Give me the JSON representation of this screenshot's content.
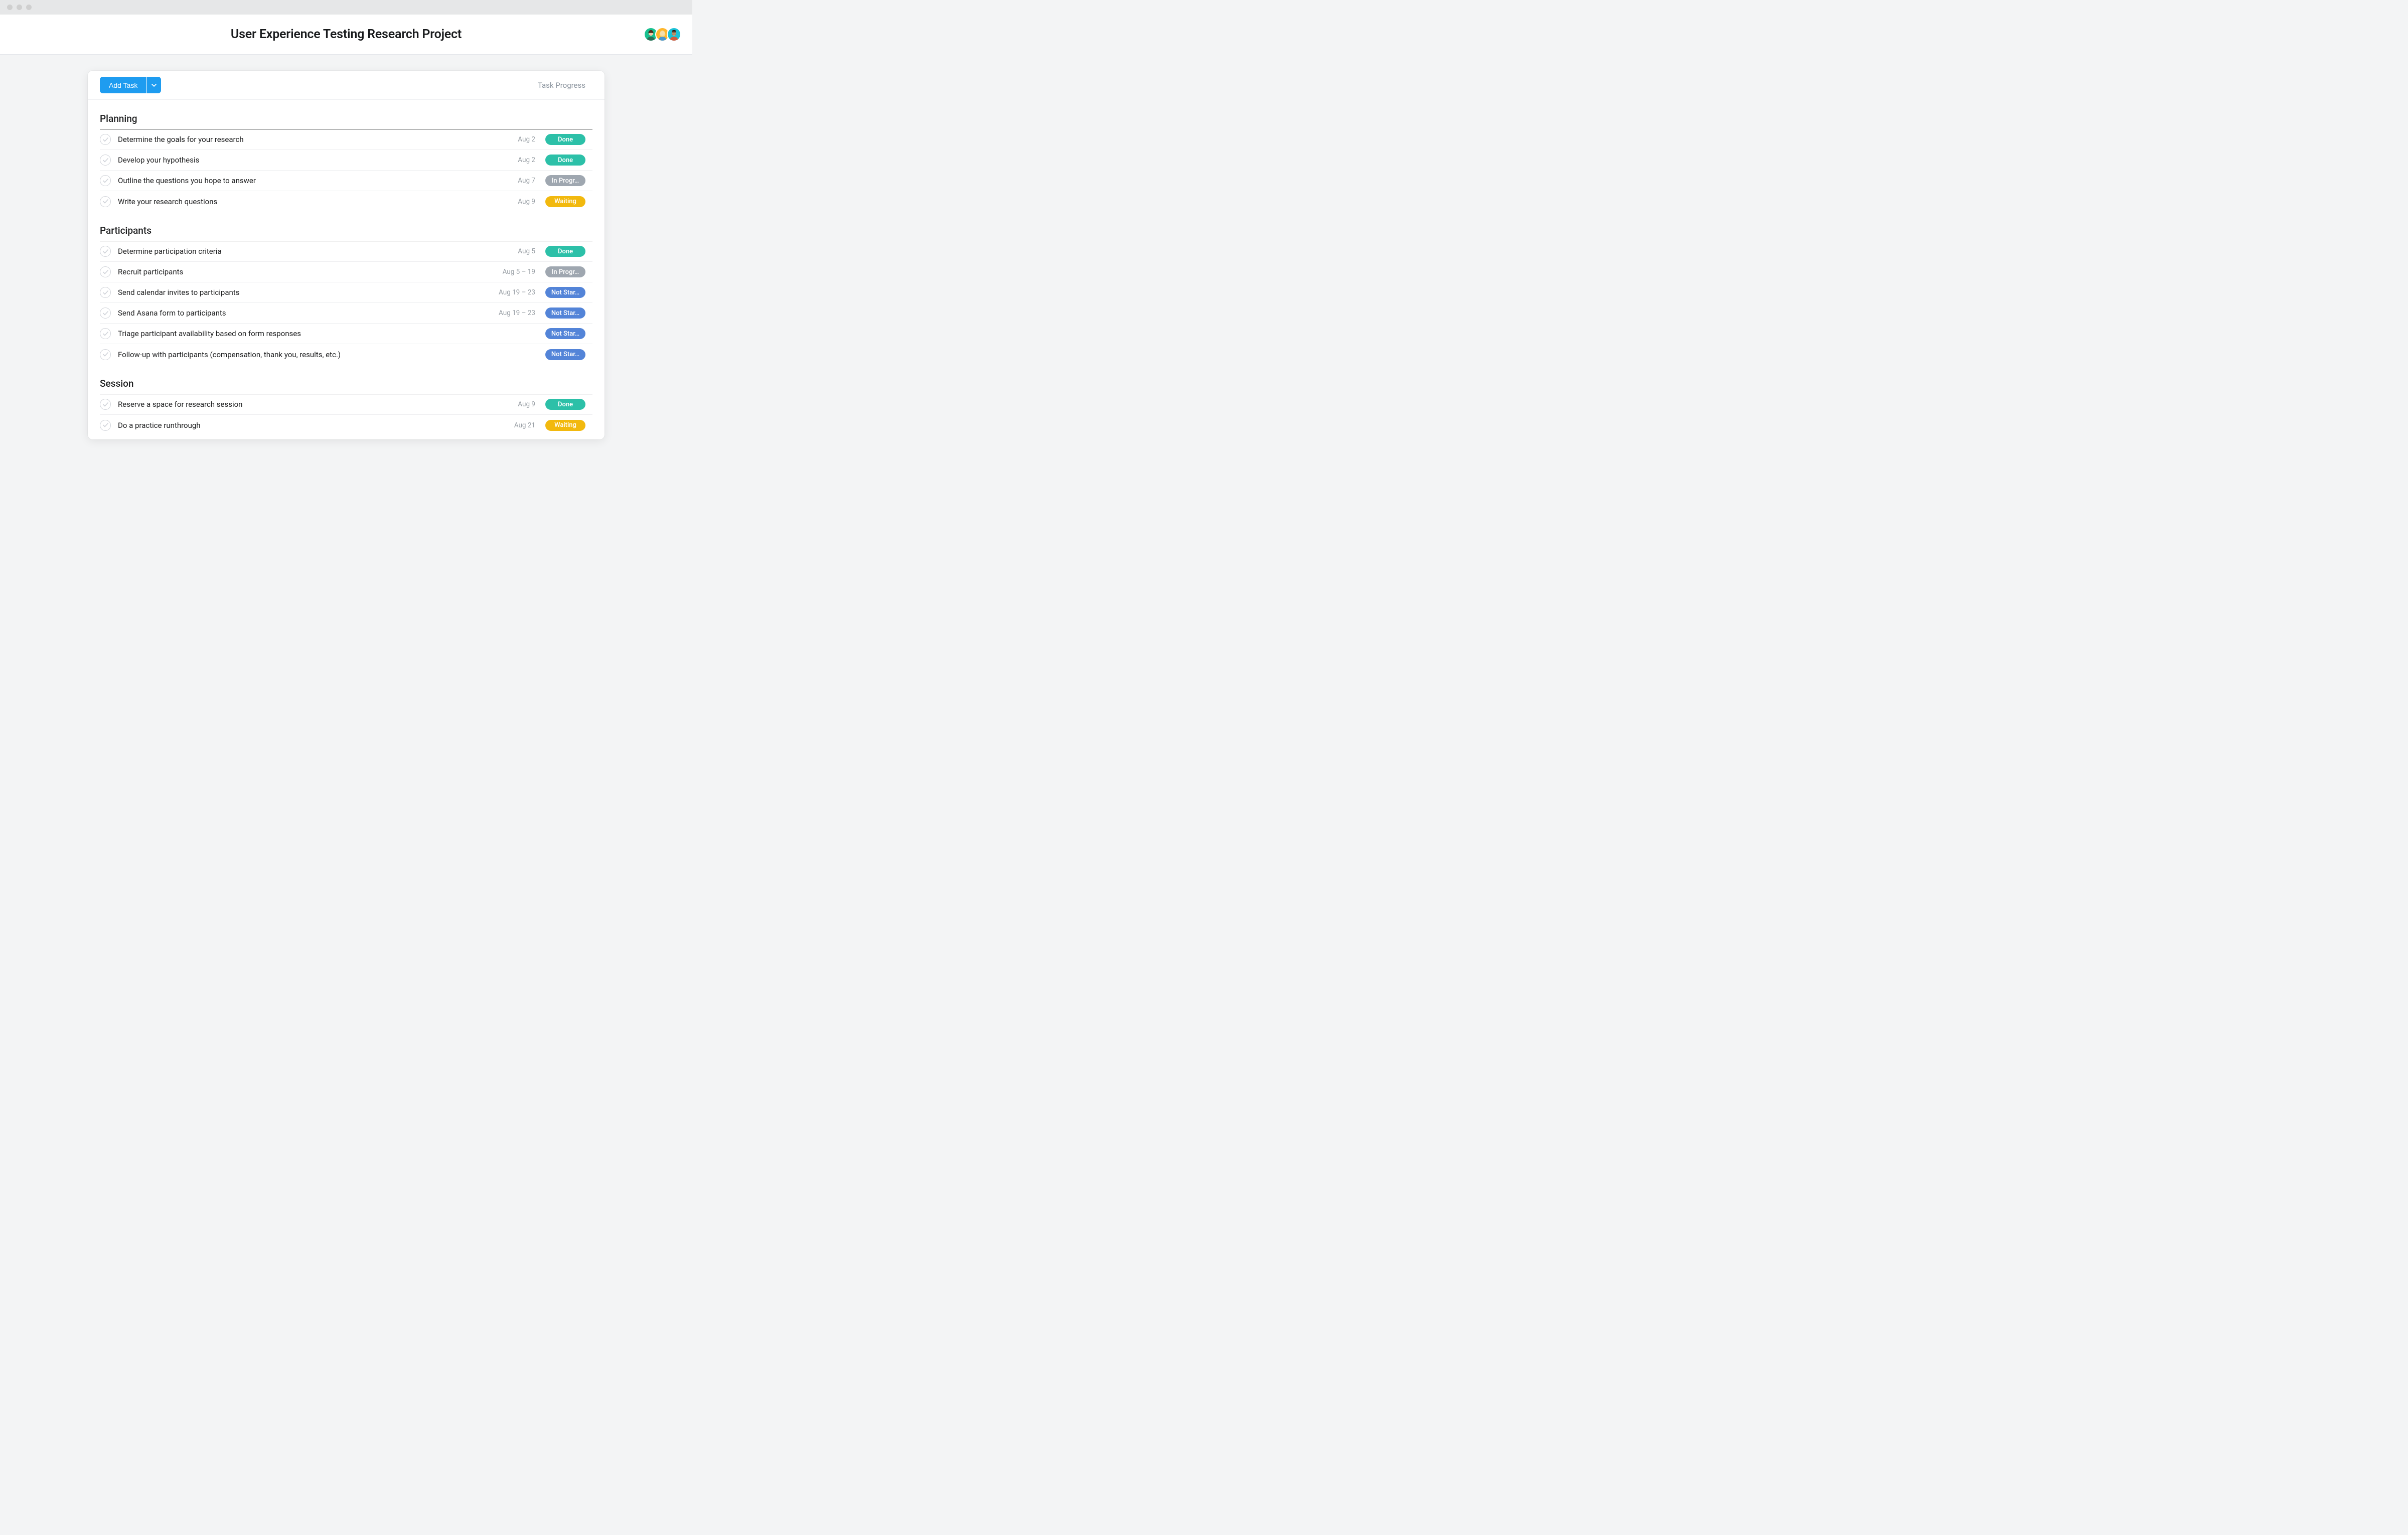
{
  "header": {
    "title": "User Experience Testing Research Project",
    "avatars": [
      {
        "bg": "#18c08f"
      },
      {
        "bg": "#ffb62b"
      },
      {
        "bg": "#1bc1d6"
      }
    ]
  },
  "toolbar": {
    "add_task_label": "Add Task",
    "task_progress_label": "Task Progress"
  },
  "sections": [
    {
      "title": "Planning",
      "tasks": [
        {
          "title": "Determine the goals for your research",
          "date": "Aug 2",
          "status": "Done",
          "status_class": "done"
        },
        {
          "title": "Develop your hypothesis",
          "date": "Aug 2",
          "status": "Done",
          "status_class": "done"
        },
        {
          "title": "Outline the questions you hope to answer",
          "date": "Aug 7",
          "status": "In Progr…",
          "status_class": "inprogress"
        },
        {
          "title": "Write your research questions",
          "date": "Aug 9",
          "status": "Waiting",
          "status_class": "waiting"
        }
      ]
    },
    {
      "title": "Participants",
      "tasks": [
        {
          "title": "Determine participation criteria",
          "date": "Aug 5",
          "status": "Done",
          "status_class": "done"
        },
        {
          "title": "Recruit participants",
          "date": "Aug 5 – 19",
          "status": "In Progr…",
          "status_class": "inprogress"
        },
        {
          "title": "Send calendar invites to participants",
          "date": "Aug 19 – 23",
          "status": "Not Star…",
          "status_class": "notstarted"
        },
        {
          "title": "Send Asana form to participants",
          "date": "Aug 19 – 23",
          "status": "Not Star…",
          "status_class": "notstarted"
        },
        {
          "title": "Triage participant availability based on form responses",
          "date": "",
          "status": "Not Star…",
          "status_class": "notstarted"
        },
        {
          "title": "Follow-up with participants (compensation, thank you, results, etc.)",
          "date": "",
          "status": "Not Star…",
          "status_class": "notstarted"
        }
      ]
    },
    {
      "title": "Session",
      "tasks": [
        {
          "title": "Reserve a space for research session",
          "date": "Aug 9",
          "status": "Done",
          "status_class": "done"
        },
        {
          "title": "Do a practice runthrough",
          "date": "Aug 21",
          "status": "Waiting",
          "status_class": "waiting"
        }
      ]
    }
  ]
}
